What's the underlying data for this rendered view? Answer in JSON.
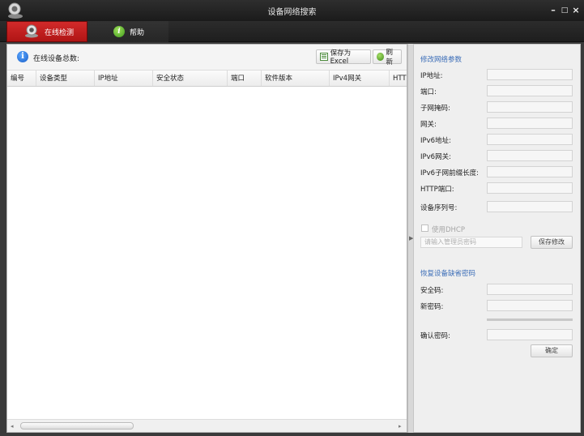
{
  "window": {
    "title": "设备网络搜索",
    "minimize": "–",
    "maximize": "□",
    "close": "×"
  },
  "tabs": [
    {
      "label": "在线检测",
      "active": true
    },
    {
      "label": "帮助",
      "active": false
    }
  ],
  "device_list": {
    "total_label": "在线设备总数:",
    "save_excel_label": "保存为Excel",
    "refresh_label": "刷新",
    "columns": [
      "编号",
      "设备类型",
      "IP地址",
      "安全状态",
      "端口",
      "软件版本",
      "IPv4网关",
      "HTT"
    ],
    "rows": []
  },
  "modify_params": {
    "title": "修改网络参数",
    "fields": [
      {
        "label": "IP地址:",
        "value": ""
      },
      {
        "label": "端口:",
        "value": ""
      },
      {
        "label": "子网掩码:",
        "value": ""
      },
      {
        "label": "网关:",
        "value": ""
      },
      {
        "label": "IPv6地址:",
        "value": ""
      },
      {
        "label": "IPv6网关:",
        "value": ""
      },
      {
        "label": "IPv6子网前缀长度:",
        "value": ""
      },
      {
        "label": "HTTP端口:",
        "value": ""
      },
      {
        "label": "设备序列号:",
        "value": ""
      }
    ],
    "dhcp_label": "使用DHCP",
    "dhcp_checked": false,
    "admin_password_placeholder": "请输入管理员密码",
    "save_label": "保存修改"
  },
  "restore_password": {
    "title": "恢复设备缺省密码",
    "security_code_label": "安全码:",
    "new_password_label": "新密码:",
    "confirm_password_label": "确认密码:",
    "confirm_label": "确定"
  },
  "colors": {
    "active_tab": "#c81e1e",
    "section_title": "#3a6cb7",
    "help_icon": "#4ea822",
    "info_icon": "#1f6fd8"
  }
}
